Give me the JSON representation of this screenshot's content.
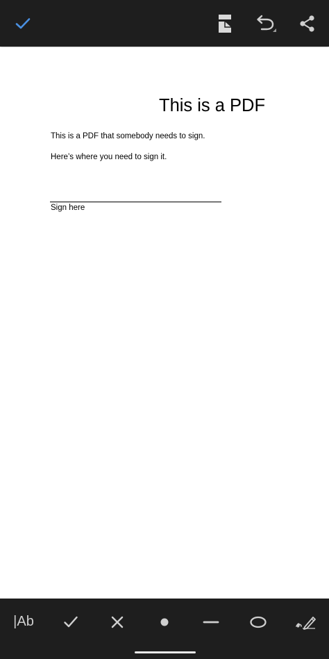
{
  "toolbar": {
    "done_icon": "checkmark-icon",
    "page_icon": "page-layout-icon",
    "undo_icon": "undo-icon",
    "share_icon": "share-icon",
    "accent_color": "#4a90e2"
  },
  "document": {
    "title": "This is a PDF",
    "paragraph_1": "This is a PDF that somebody needs to sign.",
    "paragraph_2": "Here’s where you need to sign it.",
    "signature_label": "Sign here"
  },
  "tools": {
    "text_label": "|Ab",
    "items": [
      "text-tool",
      "check-tool",
      "cross-tool",
      "dot-tool",
      "line-tool",
      "ellipse-tool",
      "signature-tool"
    ]
  }
}
